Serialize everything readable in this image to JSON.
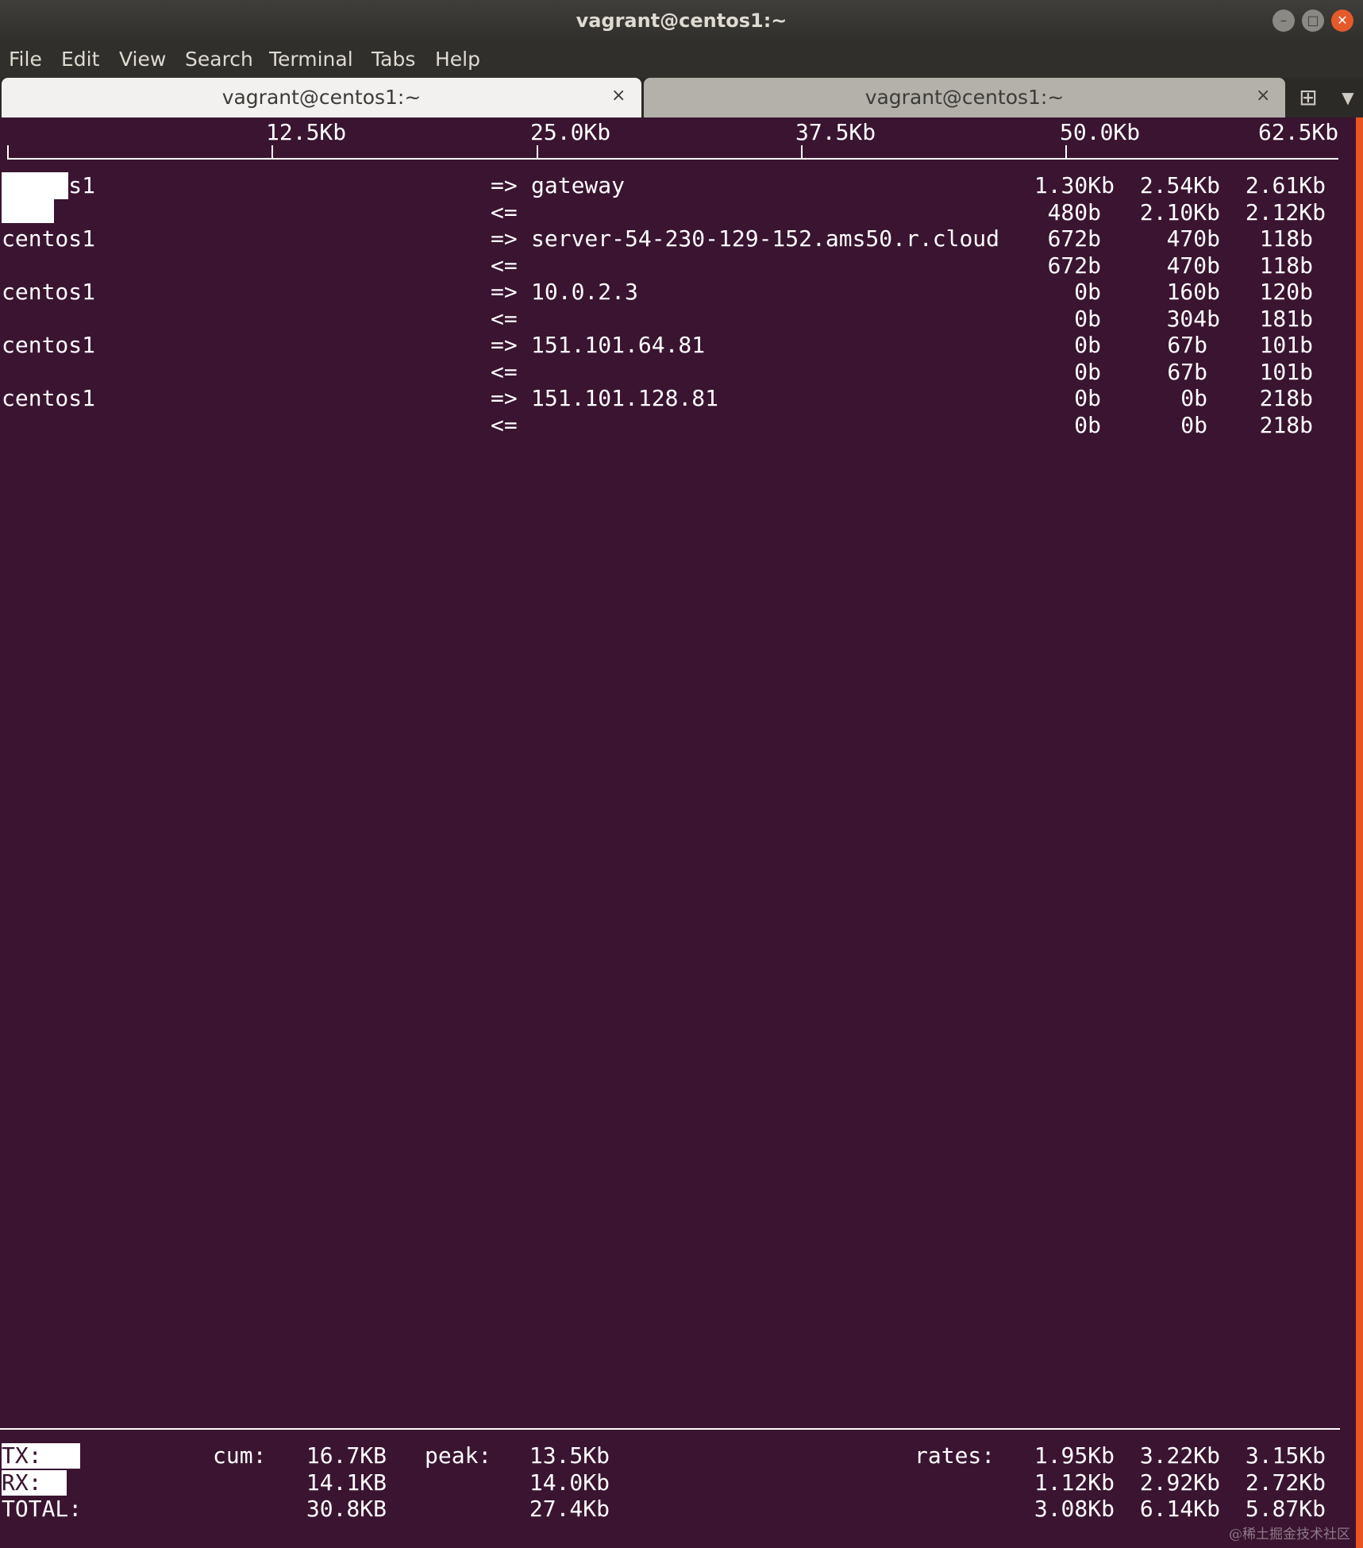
{
  "window": {
    "title": "vagrant@centos1:~",
    "accent_close": "#e45a2b",
    "background": "#3a1431"
  },
  "menu": [
    "File",
    "Edit",
    "View",
    "Search",
    "Terminal",
    "Tabs",
    "Help"
  ],
  "tabs": [
    {
      "label": "vagrant@centos1:~",
      "active": true,
      "close": "×"
    },
    {
      "label": "vagrant@centos1:~",
      "active": false,
      "close": "×"
    }
  ],
  "icons": {
    "new_tab": "new-tab-icon",
    "tab_menu": "chevron-down-icon",
    "new_tab_glyph": "⊞",
    "tab_menu_glyph": "▼"
  },
  "scale": [
    "12.5Kb",
    "25.0Kb",
    "37.5Kb",
    "50.0Kb",
    "62.5Kb"
  ],
  "connections": [
    {
      "host": "centos1",
      "remote": "gateway",
      "tx": [
        "1.30Kb",
        "2.54Kb",
        "2.61Kb"
      ],
      "rx": [
        "480b",
        "2.10Kb",
        "2.12Kb"
      ]
    },
    {
      "host": "centos1",
      "remote": "server-54-230-129-152.ams50.r.cloud",
      "tx": [
        "672b",
        "470b",
        "118b"
      ],
      "rx": [
        "672b",
        "470b",
        "118b"
      ]
    },
    {
      "host": "centos1",
      "remote": "10.0.2.3",
      "tx": [
        "0b",
        "160b",
        "120b"
      ],
      "rx": [
        "0b",
        "304b",
        "181b"
      ]
    },
    {
      "host": "centos1",
      "remote": "151.101.64.81",
      "tx": [
        "0b",
        "67b",
        "101b"
      ],
      "rx": [
        "0b",
        "67b",
        "101b"
      ]
    },
    {
      "host": "centos1",
      "remote": "151.101.128.81",
      "tx": [
        "0b",
        "0b",
        "218b"
      ],
      "rx": [
        "0b",
        "0b",
        "218b"
      ]
    }
  ],
  "arrows": {
    "out": "=>",
    "in": "<="
  },
  "totals": {
    "labels": {
      "cum": "cum:",
      "peak": "peak:",
      "rates": "rates:"
    },
    "rows": [
      {
        "label": "TX:",
        "cum": "16.7KB",
        "peak": "13.5Kb",
        "rates": [
          "1.95Kb",
          "3.22Kb",
          "3.15Kb"
        ]
      },
      {
        "label": "RX:",
        "cum": "14.1KB",
        "peak": "14.0Kb",
        "rates": [
          "1.12Kb",
          "2.92Kb",
          "2.72Kb"
        ]
      },
      {
        "label": "TOTAL:",
        "cum": "30.8KB",
        "peak": "27.4Kb",
        "rates": [
          "3.08Kb",
          "6.14Kb",
          "5.87Kb"
        ]
      }
    ]
  },
  "watermark": "@稀土掘金技术社区"
}
